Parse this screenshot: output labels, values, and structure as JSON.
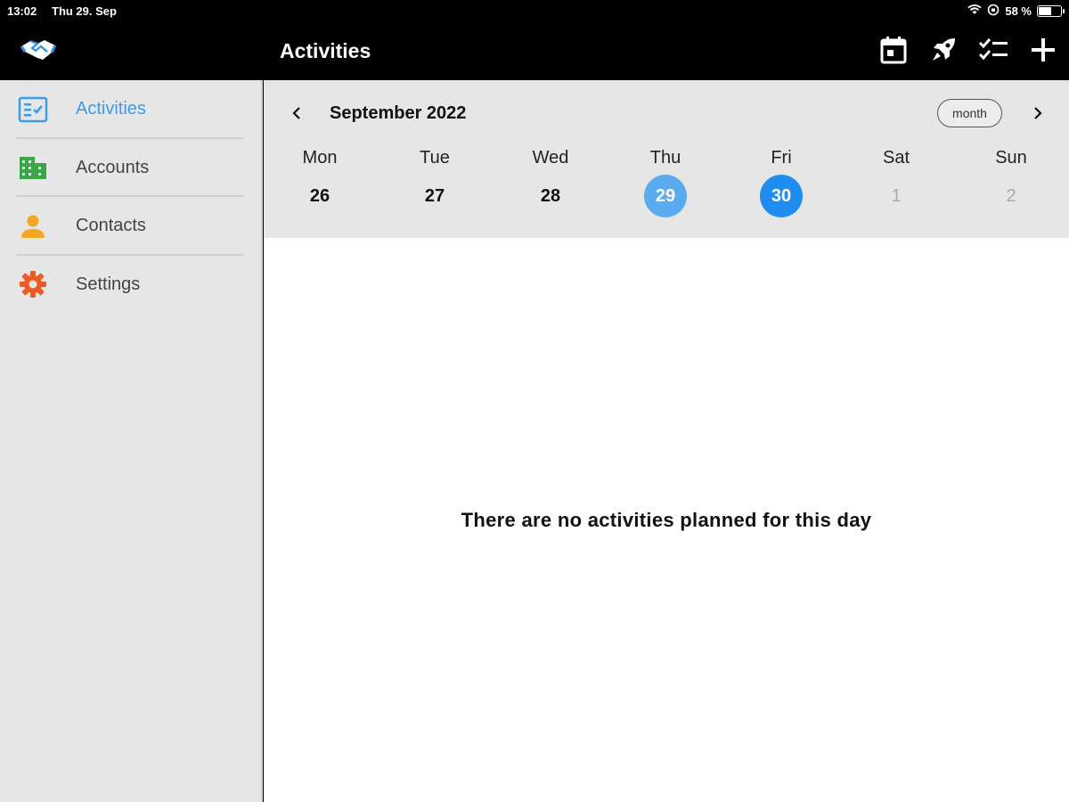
{
  "status_bar": {
    "time": "13:02",
    "date": "Thu 29. Sep",
    "battery": "58 %",
    "battery_level": 0.58
  },
  "header": {
    "title": "Activities",
    "logo_icon": "handshake-icon",
    "tools": [
      {
        "name": "calendar-icon"
      },
      {
        "name": "rocket-icon"
      },
      {
        "name": "checklist-icon"
      },
      {
        "name": "plus-icon"
      }
    ]
  },
  "sidebar": {
    "items": [
      {
        "label": "Activities",
        "icon": "activities-icon",
        "color": "#3d9be9",
        "active": true
      },
      {
        "label": "Accounts",
        "icon": "building-icon",
        "color": "#3aa84a"
      },
      {
        "label": "Contacts",
        "icon": "person-icon",
        "color": "#f5a623"
      },
      {
        "label": "Settings",
        "icon": "gear-icon",
        "color": "#f05a22"
      }
    ]
  },
  "calendar": {
    "month_label": "September 2022",
    "view_toggle": "month",
    "days": [
      {
        "name": "Mon",
        "num": "26"
      },
      {
        "name": "Tue",
        "num": "27"
      },
      {
        "name": "Wed",
        "num": "28"
      },
      {
        "name": "Thu",
        "num": "29",
        "state": "today"
      },
      {
        "name": "Fri",
        "num": "30",
        "state": "selected"
      },
      {
        "name": "Sat",
        "num": "1",
        "state": "other"
      },
      {
        "name": "Sun",
        "num": "2",
        "state": "other"
      }
    ]
  },
  "main": {
    "empty_message": "There are no activities planned for this day"
  },
  "colors": {
    "accent": "#1f8ef0",
    "today": "#5aabef"
  }
}
